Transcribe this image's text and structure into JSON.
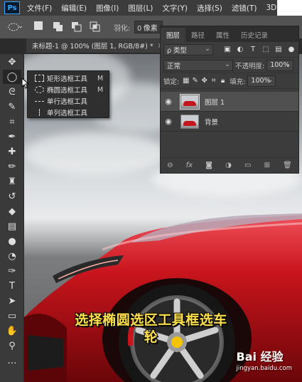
{
  "app": {
    "logo_text": "Ps"
  },
  "menu": {
    "items": [
      "文件(F)",
      "编辑(E)",
      "图像(I)",
      "图层(L)",
      "文字(Y)",
      "选择(S)",
      "滤镜(T)",
      "3D"
    ]
  },
  "options_bar": {
    "feather_label": "羽化:",
    "feather_value": "0 像素"
  },
  "document_tab": {
    "title": "未标题-1 @ 100% (图层 1, RGB/8#) *",
    "close": "×"
  },
  "toolbar": {
    "tools": [
      {
        "icon": "move-icon",
        "glyph": "✥"
      },
      {
        "icon": "elliptical-marquee-icon",
        "glyph": "◯"
      },
      {
        "icon": "lasso-icon",
        "glyph": "ᘓ"
      },
      {
        "icon": "quick-select-icon",
        "glyph": "✎"
      },
      {
        "icon": "crop-icon",
        "glyph": "⌗"
      },
      {
        "icon": "eyedropper-icon",
        "glyph": "✒"
      },
      {
        "icon": "healing-brush-icon",
        "glyph": "✚"
      },
      {
        "icon": "brush-icon",
        "glyph": "✏"
      },
      {
        "icon": "clone-stamp-icon",
        "glyph": "♜"
      },
      {
        "icon": "history-brush-icon",
        "glyph": "↺"
      },
      {
        "icon": "eraser-icon",
        "glyph": "◆"
      },
      {
        "icon": "gradient-icon",
        "glyph": "▤"
      },
      {
        "icon": "blur-icon",
        "glyph": "●"
      },
      {
        "icon": "dodge-icon",
        "glyph": "◔"
      },
      {
        "icon": "pen-icon",
        "glyph": "✑"
      },
      {
        "icon": "type-icon",
        "glyph": "T"
      },
      {
        "icon": "path-select-icon",
        "glyph": "➤"
      },
      {
        "icon": "rectangle-icon",
        "glyph": "▭"
      },
      {
        "icon": "hand-icon",
        "glyph": "✋"
      },
      {
        "icon": "zoom-icon",
        "glyph": "⚲"
      },
      {
        "icon": "more-tools-icon",
        "glyph": "…"
      }
    ]
  },
  "flyout": {
    "items": [
      {
        "label": "矩形选框工具",
        "shortcut": "M",
        "icon": "rect-marquee-icon"
      },
      {
        "label": "椭圆选框工具",
        "shortcut": "M",
        "icon": "ellipse-marquee-icon"
      },
      {
        "label": "单行选框工具",
        "shortcut": "",
        "icon": "single-row-marquee-icon"
      },
      {
        "label": "单列选框工具",
        "shortcut": "",
        "icon": "single-column-marquee-icon"
      }
    ]
  },
  "layers_panel": {
    "tabs": [
      "图层",
      "路径",
      "属性",
      "历史记录"
    ],
    "filter_kind": "ρ 类型",
    "blend_mode": "正常",
    "opacity_label": "不透明度:",
    "opacity_value": "100%",
    "lock_label": "锁定:",
    "fill_label": "填充:",
    "fill_value": "100%",
    "layers": [
      {
        "name": "图层 1",
        "selected": true
      },
      {
        "name": "背景",
        "selected": false
      }
    ],
    "footer_icons": [
      "link-icon",
      "fx-icon",
      "mask-icon",
      "adjustment-icon",
      "group-icon",
      "new-layer-icon",
      "delete-icon"
    ],
    "footer_fx": "fx"
  },
  "subtitle": {
    "line1": "选择椭圆选区工具框选车",
    "line2": "轮"
  },
  "watermark": {
    "brand": "Bai 经验",
    "url": "jingyan.baidu.com"
  }
}
